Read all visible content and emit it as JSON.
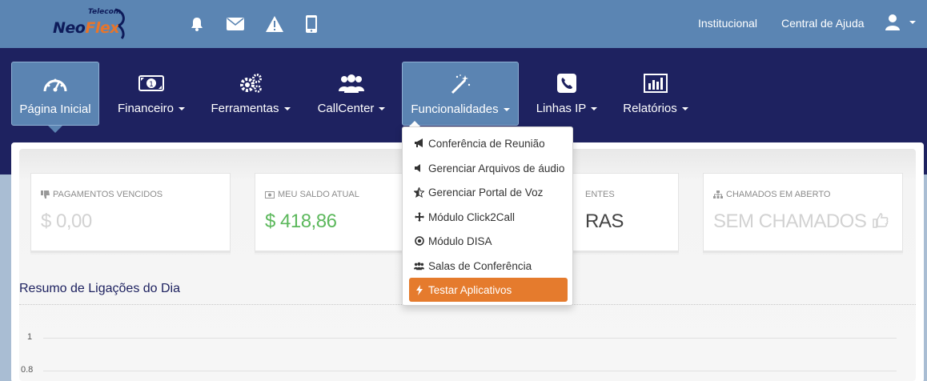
{
  "brand": {
    "name_left": "Neo",
    "name_right": "Flex",
    "tagline": "Telecom"
  },
  "top_icons": [
    "bell-icon",
    "envelope-icon",
    "warning-icon",
    "mobile-icon"
  ],
  "top_links": {
    "institucional": "Institucional",
    "ajuda": "Central de Ajuda"
  },
  "nav": {
    "items": [
      {
        "label": "Página Inicial",
        "icon": "dashboard-icon",
        "active": true
      },
      {
        "label": "Financeiro",
        "icon": "money-icon"
      },
      {
        "label": "Ferramentas",
        "icon": "gears-icon"
      },
      {
        "label": "CallCenter",
        "icon": "users-icon"
      },
      {
        "label": "Funcionalidades",
        "icon": "magic-wand-icon",
        "open": true
      },
      {
        "label": "Linhas IP",
        "icon": "phone-icon"
      },
      {
        "label": "Relatórios",
        "icon": "bar-chart-icon"
      }
    ]
  },
  "dropdown": {
    "items": [
      {
        "label": "Conferência de Reunião",
        "icon": "bullhorn-icon"
      },
      {
        "label": "Gerenciar Arquivos de áudio",
        "icon": "volume-icon"
      },
      {
        "label": "Gerenciar Portal de Voz",
        "icon": "star-half-icon"
      },
      {
        "label": "Módulo Click2Call",
        "icon": "arrows-icon"
      },
      {
        "label": "Módulo DISA",
        "icon": "dot-circle-icon"
      },
      {
        "label": "Salas de Conferência",
        "icon": "group-icon"
      },
      {
        "label": "Testar Aplicativos",
        "icon": "bolt-icon",
        "highlighted": true
      }
    ]
  },
  "cards": [
    {
      "label": "PAGAMENTOS VENCIDOS",
      "value": "$ 0,00",
      "icon": "thumbs-down-icon"
    },
    {
      "label": "MEU SALDO ATUAL",
      "value": "$ 418,86",
      "icon": "money-icon"
    },
    {
      "label": "ENTES",
      "value": "RAS",
      "icon": ""
    },
    {
      "label": "CHAMADOS EM ABERTO",
      "value": "SEM CHAMADOS",
      "icon": "sitemap-icon"
    }
  ],
  "section": {
    "title": "Resumo de Ligações do Dia"
  },
  "chart_data": {
    "type": "line",
    "y_ticks": [
      "1",
      "0.8"
    ]
  },
  "colors": {
    "topbar": "#5b85b3",
    "nav": "#1e2260",
    "accent": "#e57b2d",
    "green": "#5cb85c"
  }
}
